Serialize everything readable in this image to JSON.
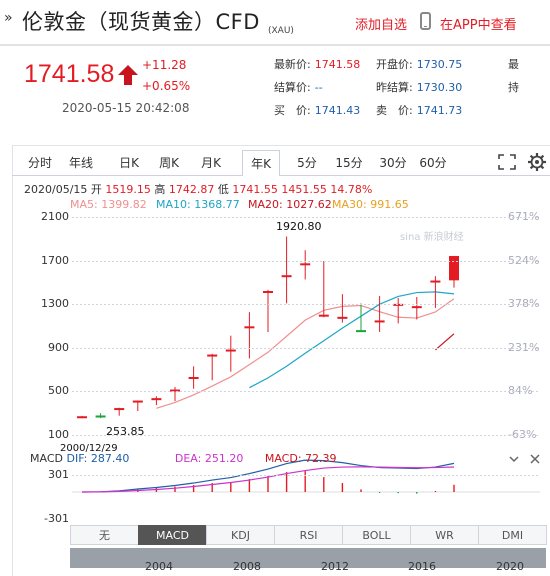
{
  "header": {
    "title_mark": "»",
    "title": "伦敦金（现货黄金）CFD",
    "subtitle": "(XAU)",
    "add_favorite": "添加自选",
    "app_view": "在APP中查看"
  },
  "quote": {
    "price": "1741.58",
    "change": "+11.28",
    "change_pct": "+0.65%",
    "timestamp": "2020-05-15 20:42:08",
    "stats": [
      {
        "label": "最新价:",
        "value": "1741.58",
        "red": true
      },
      {
        "label": "开盘价:",
        "value": "1730.75",
        "red": false
      },
      {
        "label": "最",
        "value": "",
        "red": false
      },
      {
        "label": "结算价:",
        "value": "--",
        "red": false
      },
      {
        "label": "昨结算:",
        "value": "1730.30",
        "red": false
      },
      {
        "label": "持",
        "value": "",
        "red": false
      },
      {
        "label": "买　价:",
        "value": "1741.43",
        "red": false
      },
      {
        "label": "卖　价:",
        "value": "1741.73",
        "red": false
      },
      {
        "label": "",
        "value": "",
        "red": false
      }
    ]
  },
  "chart_tabs": [
    "分时",
    "年线",
    "日K",
    "周K",
    "月K",
    "年K",
    "5分",
    "15分",
    "30分",
    "60分"
  ],
  "active_chart_tab": "年K",
  "ohlc": {
    "date": "2020/05/15",
    "open_label": "开",
    "open": "1519.15",
    "high_label": "高",
    "high": "1742.87",
    "low_label": "低",
    "low": "1741.55",
    "low2": "1451.55",
    "pct": "14.78%"
  },
  "ma": [
    {
      "label": "MA5:",
      "value": "1399.82",
      "color": "#f08f8f"
    },
    {
      "label": "MA10:",
      "value": "1368.77",
      "color": "#1ea6c7"
    },
    {
      "label": "MA20:",
      "value": "1027.62",
      "color": "#c8141e"
    },
    {
      "label": "MA30:",
      "value": "991.65",
      "color": "#e7a020"
    }
  ],
  "watermark": "sina 新浪财经",
  "axis": {
    "price_ticks": [
      "2100",
      "1700",
      "1300",
      "900",
      "500",
      "100"
    ],
    "pct_ticks": [
      "671%",
      "524%",
      "378%",
      "231%",
      "84%",
      "-63%"
    ],
    "max_label": "1920.80",
    "min_label": "253.85",
    "start_date": "2000/12/29"
  },
  "macd": {
    "label": "MACD",
    "dif_label": "DIF:",
    "dif": "287.40",
    "dea_label": "DEA:",
    "dea": "251.20",
    "macd_label": "MACD:",
    "macd": "72.39",
    "tick_top": "301",
    "tick_bottom": "-301"
  },
  "indicator_tabs": [
    "无",
    "MACD",
    "KDJ",
    "RSI",
    "BOLL",
    "WR",
    "DMI"
  ],
  "active_indicator": "MACD",
  "nav_years": [
    "2004",
    "2008",
    "2012",
    "2016",
    "2020"
  ],
  "colors": {
    "up": "#e31c23",
    "down": "#19a33a",
    "link": "#1f5fa8"
  },
  "chart_data": {
    "type": "candlestick",
    "x": [
      "2000",
      "2001",
      "2002",
      "2003",
      "2004",
      "2005",
      "2006",
      "2007",
      "2008",
      "2009",
      "2010",
      "2011",
      "2012",
      "2013",
      "2014",
      "2015",
      "2016",
      "2017",
      "2018",
      "2019",
      "2020"
    ],
    "open": [
      272,
      279,
      344,
      416,
      437,
      513,
      632,
      836,
      869,
      1095,
      1421,
      1565,
      1659,
      1202,
      1184,
      1062,
      1146,
      1303,
      1282,
      1517,
      1519
    ],
    "close": [
      272,
      277,
      347,
      416,
      438,
      517,
      632,
      838,
      884,
      1097,
      1421,
      1566,
      1675,
      1204,
      1184,
      1061,
      1151,
      1303,
      1282,
      1517,
      1742
    ],
    "high": [
      275,
      300,
      350,
      417,
      455,
      540,
      730,
      845,
      1011,
      1227,
      1431,
      1921,
      1795,
      1696,
      1392,
      1308,
      1375,
      1357,
      1366,
      1557,
      1743
    ],
    "low": [
      254,
      255,
      277,
      320,
      375,
      411,
      524,
      602,
      681,
      802,
      1044,
      1308,
      1527,
      1180,
      1131,
      1046,
      1046,
      1124,
      1160,
      1266,
      1452
    ],
    "ylim": [
      100,
      2100
    ],
    "ma5": [
      null,
      null,
      null,
      null,
      345,
      399,
      468,
      549,
      634,
      746,
      859,
      1006,
      1154,
      1244,
      1280,
      1288,
      1231,
      1180,
      1173,
      1229,
      1350
    ],
    "ma10": [
      null,
      null,
      null,
      null,
      null,
      null,
      null,
      null,
      null,
      534,
      624,
      731,
      850,
      965,
      1081,
      1190,
      1300,
      1371,
      1407,
      1413,
      1395
    ],
    "ma20": [
      null,
      null,
      null,
      null,
      null,
      null,
      null,
      null,
      null,
      null,
      null,
      null,
      null,
      null,
      null,
      null,
      null,
      null,
      null,
      880,
      1028
    ],
    "ma30": [
      null,
      null,
      null,
      null,
      null,
      null,
      null,
      null,
      null,
      null,
      null,
      null,
      null,
      null,
      null,
      null,
      null,
      null,
      null,
      null,
      992
    ],
    "macd_dif": [
      0,
      2,
      12,
      30,
      45,
      65,
      90,
      120,
      145,
      185,
      230,
      285,
      320,
      315,
      295,
      265,
      245,
      240,
      235,
      250,
      287
    ],
    "macd_dea": [
      0,
      1,
      6,
      15,
      25,
      38,
      55,
      75,
      95,
      120,
      150,
      185,
      215,
      240,
      250,
      252,
      250,
      246,
      243,
      245,
      251
    ],
    "macd_ylim": [
      -301,
      301
    ]
  }
}
